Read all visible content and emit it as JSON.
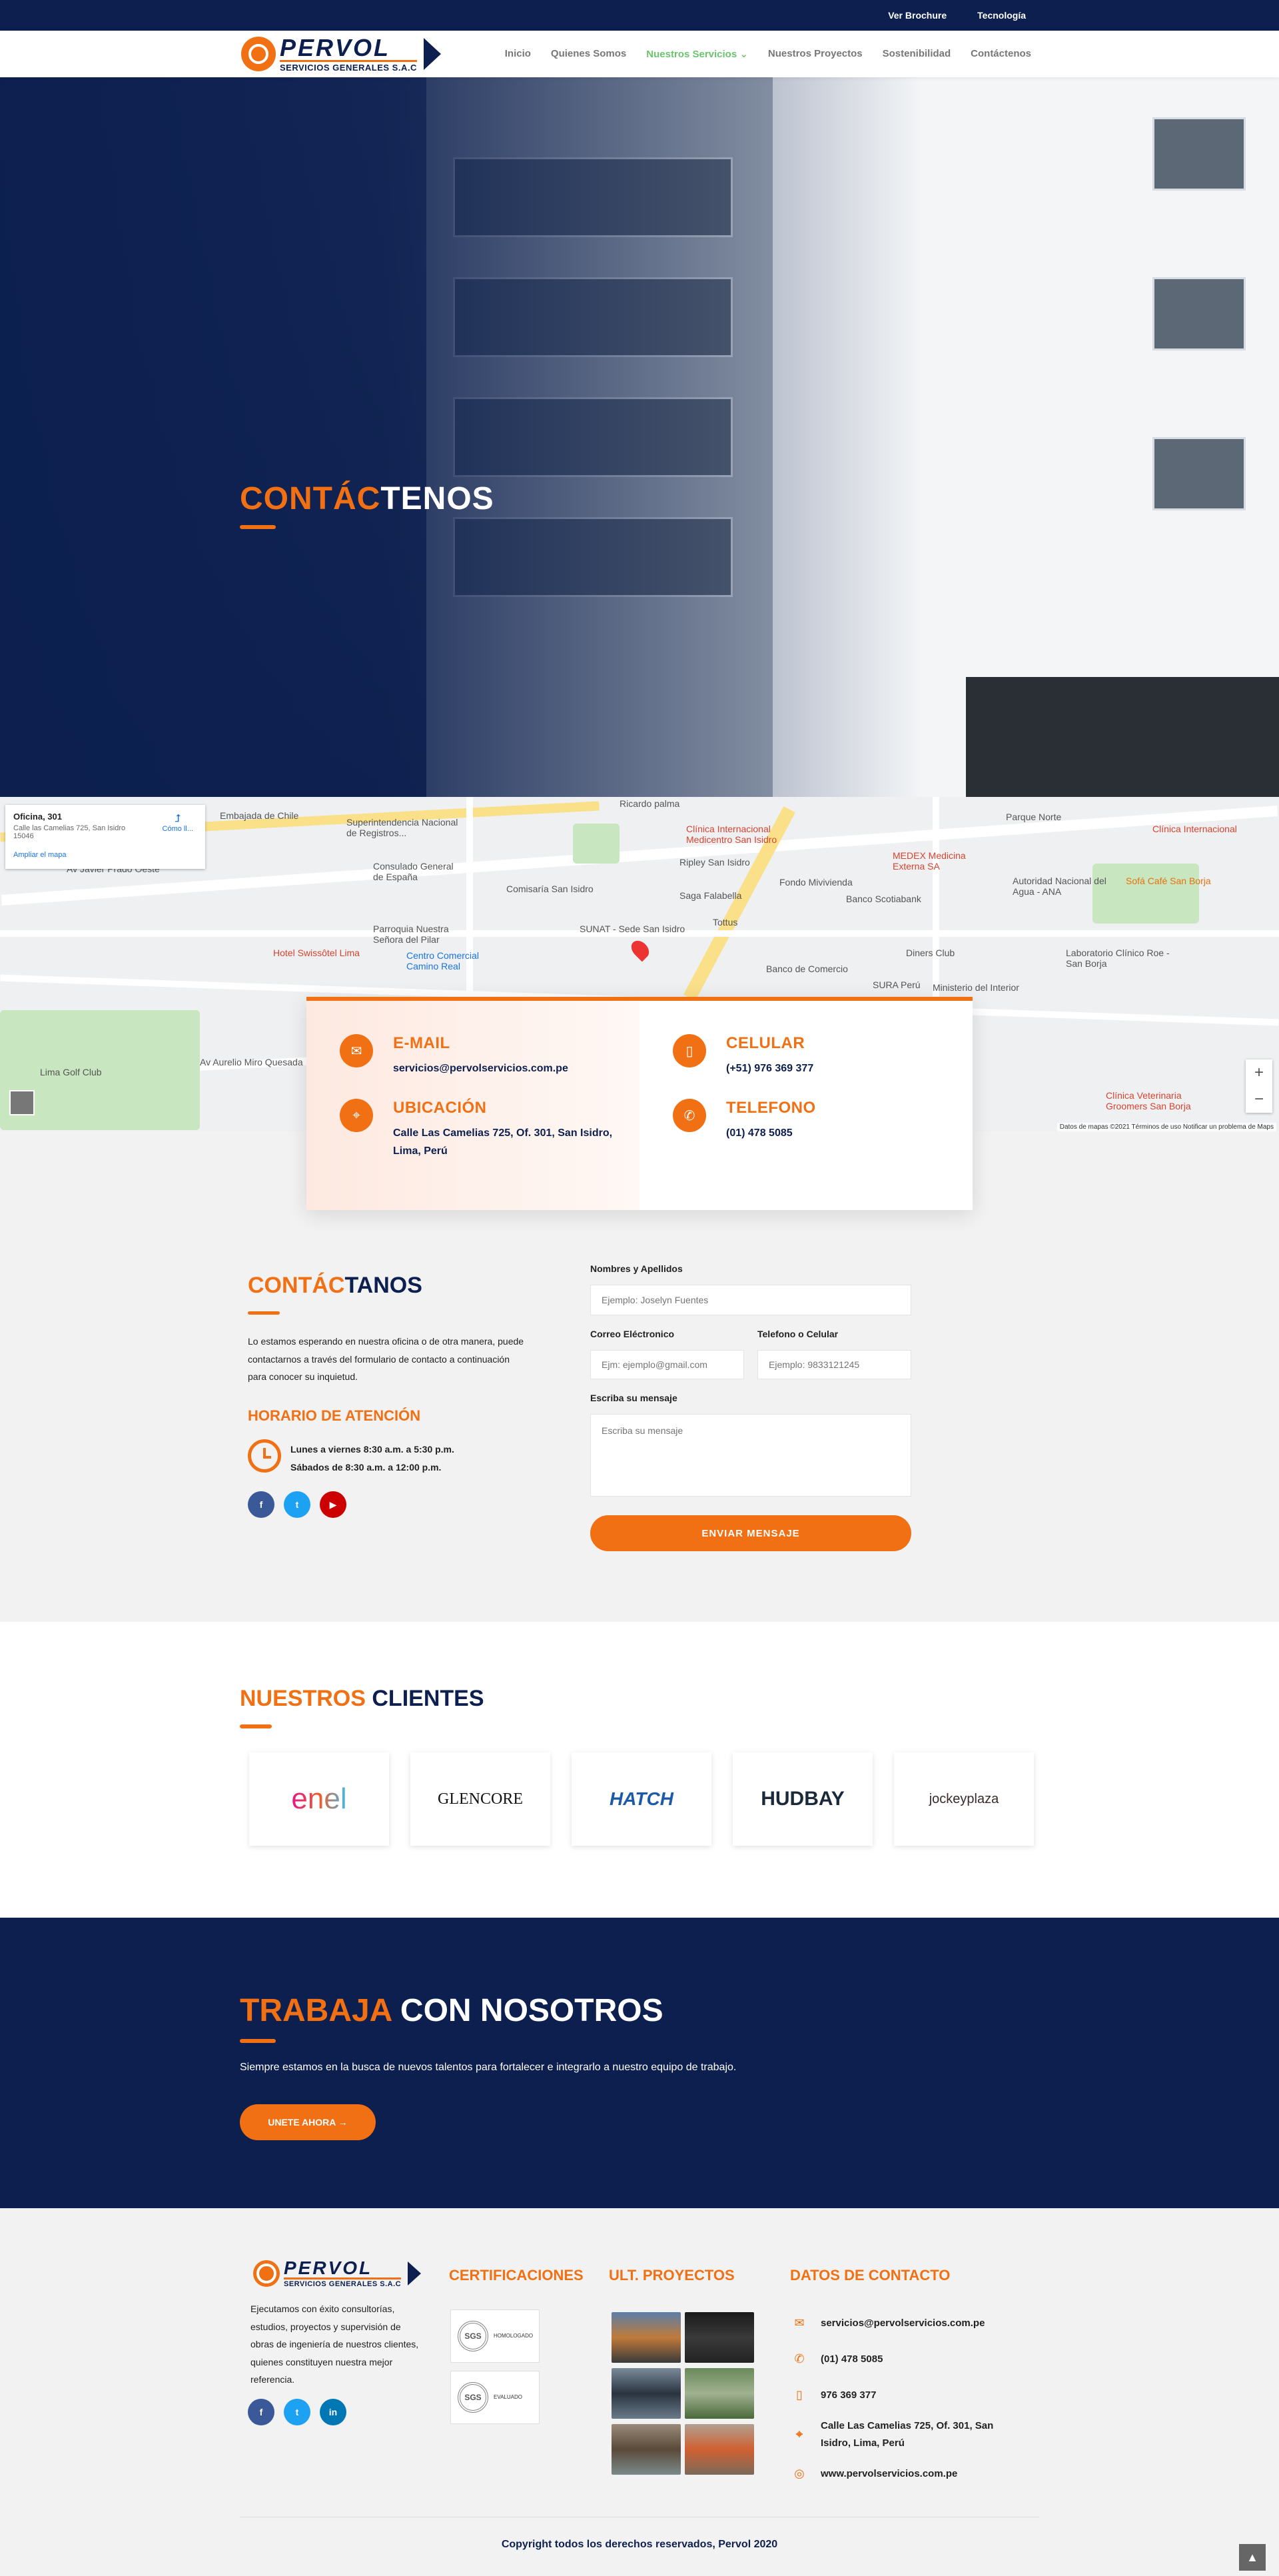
{
  "topbar": {
    "brochure": "Ver Brochure",
    "tech": "Tecnología"
  },
  "brand": {
    "name": "PERVOL",
    "sub": "SERVICIOS GENERALES S.A.C"
  },
  "nav": [
    "Inicio",
    "Quienes Somos",
    "Nuestros Servicios ⌄",
    "Nuestros Proyectos",
    "Sostenibilidad",
    "Contáctenos"
  ],
  "hero": {
    "title_accent": "CONTÁC",
    "title_rest": "TENOS"
  },
  "map": {
    "card_title": "Oficina, 301",
    "card_address": "Calle las Camelias 725, San Isidro 15046",
    "card_link": "Ampliar el mapa",
    "card_directions": "Cómo ll...",
    "labels": [
      "Embajada de Chile",
      "Superintendencia Nacional de Registros...",
      "Ricardo palma",
      "Clínica Internacional Medicentro San Isidro",
      "Parque Norte",
      "Clínica Internacional",
      "Consulado General de España",
      "Comisaría San Isidro",
      "MEDEX Medicina Externa SA",
      "Ripley San Isidro",
      "Saga Falabella",
      "Fondo Mivivienda",
      "Banco Scotiabank",
      "Autoridad Nacional del Agua - ANA",
      "Sofá Café San Borja",
      "Parroquia Nuestra Señora del Pilar",
      "Centro Comercial Camino Real",
      "Hotel Swissôtel Lima",
      "Tottus",
      "SUNAT - Sede San Isidro",
      "Diners Club",
      "Laboratorio Clínico Roe - San Borja",
      "Banco de Comercio",
      "SURA Perú",
      "Ministerio del Interior",
      "Lima Golf Club",
      "Av Javier Prado Oeste",
      "Av Aurelio Miro Quesada",
      "Clínica Veterinaria Groomers San Borja"
    ],
    "footer": "Datos de mapas ©2021   Términos de uso   Notificar un problema de Maps"
  },
  "contact_card": {
    "email_title": "E-MAIL",
    "email_value": "servicios@pervolservicios.com.pe",
    "celular_title": "CELULAR",
    "celular_value": "(+51) 976 369 377",
    "ubicacion_title": "UBICACIÓN",
    "ubicacion_value": "Calle Las Camelias 725, Of. 301, San Isidro, Lima, Perú",
    "telefono_title": "TELEFONO",
    "telefono_value": "(01) 478 5085"
  },
  "contact_section": {
    "title_accent": "CONTÁC",
    "title_rest": "TANOS",
    "text": "Lo estamos esperando en nuestra oficina o de otra manera, puede contactarnos a través del formulario de contacto a continuación para conocer su inquietud.",
    "horario_title": "HORARIO DE ATENCIÓN",
    "hours_1": "Lunes a viernes 8:30 a.m. a 5:30 p.m.",
    "hours_2": "Sábados de 8:30 a.m. a 12:00 p.m."
  },
  "form": {
    "name_label": "Nombres y Apellidos",
    "name_placeholder": "Ejemplo: Joselyn Fuentes",
    "email_label": "Correo Eléctronico",
    "email_placeholder": "Ejm: ejemplo@gmail.com",
    "phone_label": "Telefono o Celular",
    "phone_placeholder": "Ejemplo: 9833121245",
    "msg_label": "Escriba su mensaje",
    "msg_placeholder": "Escriba su mensaje",
    "submit": "ENVIAR MENSAJE"
  },
  "clients": {
    "title_accent": "NUESTROS",
    "title_rest": "CLIENTES",
    "logos": [
      "enel",
      "GLENCORE",
      "HATCH",
      "HUDBAY",
      "jockeyplaza"
    ]
  },
  "work": {
    "title_accent": "TRABAJA",
    "title_rest": "CON NOSOTROS",
    "text": "Siempre estamos en la busca de nuevos talentos para fortalecer e integrarlo a nuestro equipo de trabajo.",
    "button": "UNETE AHORA →"
  },
  "footer": {
    "about": "Ejecutamos con éxito consultorías, estudios, proyectos y supervisión de obras de ingeniería de nuestros clientes, quienes constituyen nuestra mejor referencia.",
    "cert_title": "CERTIFICACIONES",
    "cert_1_seal": "SGS",
    "cert_1_text": "HOMOLOGADO",
    "cert_2_seal": "SGS",
    "cert_2_text": "EVALUADO",
    "proj_title": "ULT. PROYECTOS",
    "datos_title": "DATOS DE CONTACTO",
    "email": "servicios@pervolservicios.com.pe",
    "phone": "(01) 478 5085",
    "cell": "976 369 377",
    "address": "Calle Las Camelias 725, Of. 301, San Isidro, Lima, Perú",
    "web": "www.pervolservicios.com.pe",
    "copyright": "Copyright todos los derechos reservados, Pervol 2020"
  },
  "colors": {
    "navy": "#0c1f4f",
    "orange": "#f07013",
    "green_active": "#6cc36e"
  }
}
